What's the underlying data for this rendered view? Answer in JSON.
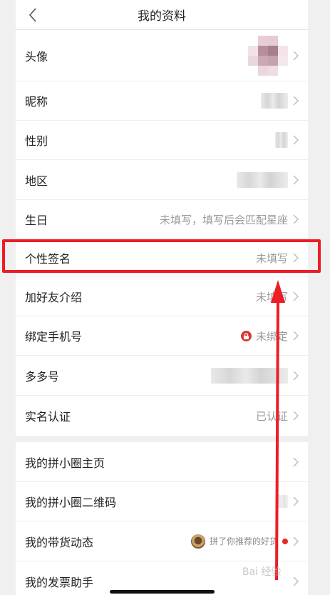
{
  "header": {
    "title": "我的资料",
    "back_icon": "chevron-left-icon"
  },
  "profile": [
    {
      "label": "头像"
    },
    {
      "label": "昵称"
    },
    {
      "label": "性别"
    },
    {
      "label": "地区"
    },
    {
      "label": "生日",
      "value": "未填写，填写后会匹配星座"
    },
    {
      "label": "个性签名",
      "value": "未填写"
    },
    {
      "label": "加好友介绍",
      "value": "未填写"
    },
    {
      "label": "绑定手机号",
      "value": "未绑定",
      "icon": "lock-icon"
    },
    {
      "label": "多多号"
    },
    {
      "label": "实名认证",
      "value": "已认证"
    }
  ],
  "social": [
    {
      "label": "我的拼小圈主页"
    },
    {
      "label": "我的拼小圈二维码"
    },
    {
      "label": "我的带货动态",
      "value": "拼了你推荐的好货"
    },
    {
      "label": "我的发票助手"
    }
  ],
  "colors": {
    "annotation_red": "#ee1c24",
    "badge_red": "#e02e24"
  },
  "watermark": "Bai 经验"
}
